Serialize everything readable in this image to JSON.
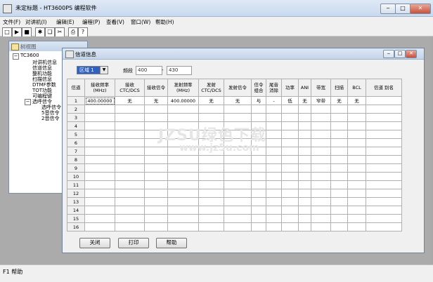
{
  "main": {
    "title": "未定标题 - HT3600PS 编程软件"
  },
  "menubar": [
    "文件(F)",
    "对讲机(I)",
    "编辑(E)",
    "编程(P)",
    "查看(V)",
    "窗口(W)",
    "帮助(H)"
  ],
  "toolbar": [
    "□",
    "▶",
    "■",
    "|",
    "✱",
    "❏",
    "✂",
    "|",
    "⎙",
    "?"
  ],
  "tree_window": {
    "title": "树视图",
    "root": "TC3600",
    "items": [
      "对讲机信息",
      "信道信息",
      "整机功能",
      "扫描信息",
      "DTMF参数",
      "TOT功能",
      "可编程键",
      "选呼信令"
    ],
    "sub_items": [
      "选呼信令",
      "5音信令",
      "2音信令"
    ]
  },
  "channel_window": {
    "title": "信道信息",
    "zone_select": "区域 1",
    "band_label": "频段",
    "band_low": "400",
    "band_sep": "-",
    "band_high": "430",
    "columns": [
      "信道",
      "接收频率 (MHz)",
      "接收 CTC/DCS",
      "接收信令",
      "发射频率 (MHz)",
      "发射 CTC/DCS",
      "发射信令",
      "信令 组合",
      "尾音 消除",
      "功率",
      "ANI",
      "带宽",
      "扫描",
      "BCL",
      "信道 别名"
    ],
    "rows": [
      [
        "1",
        "400.00000",
        "无",
        "无",
        "400.00000",
        "无",
        "无",
        "与",
        "-",
        "低",
        "无",
        "窄带",
        "无",
        "无",
        ""
      ],
      [
        "2"
      ],
      [
        "3"
      ],
      [
        "4"
      ],
      [
        "5"
      ],
      [
        "6"
      ],
      [
        "7"
      ],
      [
        "8"
      ],
      [
        "9"
      ],
      [
        "10"
      ],
      [
        "11"
      ],
      [
        "12"
      ],
      [
        "13"
      ],
      [
        "14"
      ],
      [
        "15"
      ],
      [
        "16"
      ]
    ],
    "buttons": {
      "close": "关闭",
      "print": "打印",
      "help": "帮助"
    }
  },
  "status": "F1 帮助",
  "watermark": {
    "line1": "JZSU绿色下载",
    "line2": "www.jz5u.com"
  }
}
